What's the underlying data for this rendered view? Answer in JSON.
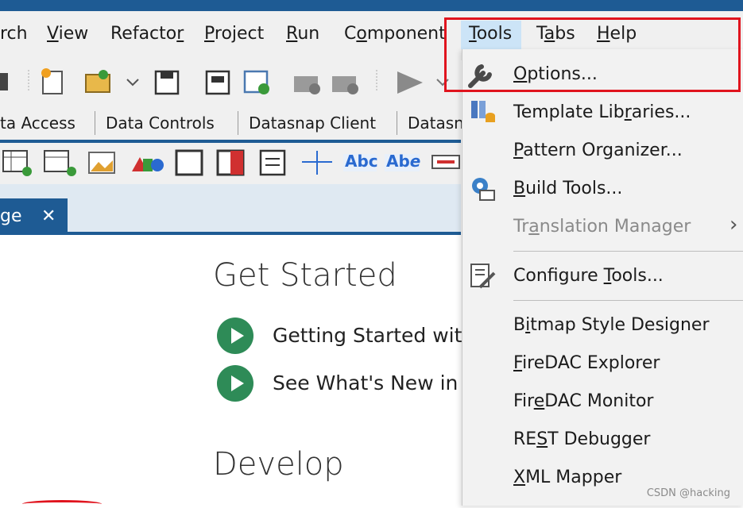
{
  "menubar": {
    "items": [
      {
        "label": "rch",
        "u": -1
      },
      {
        "label": "View",
        "u": 0
      },
      {
        "label": "Refactor",
        "u": 7
      },
      {
        "label": "Project",
        "u": 0
      },
      {
        "label": "Run",
        "u": 0
      },
      {
        "label": "Component",
        "u": 1
      },
      {
        "label": "Tools",
        "u": 0
      },
      {
        "label": "Tabs",
        "u": 1
      },
      {
        "label": "Help",
        "u": 0
      }
    ]
  },
  "palette": {
    "tabs": [
      "ta Access",
      "Data Controls",
      "Datasnap Client",
      "Datasn"
    ]
  },
  "editor_tab": {
    "label": "ge",
    "close": "✕"
  },
  "welcome": {
    "get_started": "Get Started",
    "link1": "Getting Started with",
    "link2": "See What's New in I",
    "develop": "Develop"
  },
  "tools_menu": {
    "items": [
      {
        "label": "Options...",
        "u": 0,
        "disabled": false,
        "icon": "wrench-icon"
      },
      {
        "label": "Template Libraries...",
        "u": 12,
        "disabled": false,
        "icon": "template-libraries-icon"
      },
      {
        "label": "Pattern Organizer...",
        "u": 0,
        "disabled": false,
        "icon": ""
      },
      {
        "label": "Build Tools...",
        "u": 0,
        "disabled": false,
        "icon": "build-tools-icon"
      },
      {
        "label": "Translation Manager",
        "u": 2,
        "disabled": true,
        "icon": "",
        "submenu": "›"
      },
      {
        "label": "Configure Tools...",
        "u": 10,
        "disabled": false,
        "icon": "configure-tools-icon"
      },
      {
        "label": "Bitmap Style Designer",
        "u": 1,
        "disabled": false,
        "icon": ""
      },
      {
        "label": "FireDAC Explorer",
        "u": 0,
        "disabled": false,
        "icon": ""
      },
      {
        "label": "FireDAC Monitor",
        "u": 3,
        "disabled": false,
        "icon": ""
      },
      {
        "label": "REST Debugger",
        "u": 2,
        "disabled": false,
        "icon": ""
      },
      {
        "label": "XML Mapper",
        "u": 0,
        "disabled": false,
        "icon": ""
      }
    ]
  },
  "watermark": "CSDN @hacking",
  "colors": {
    "accent": "#1e5b94",
    "highlight_border": "#e0141e",
    "menu_hover": "#cce4f7",
    "play": "#2e8b57"
  }
}
